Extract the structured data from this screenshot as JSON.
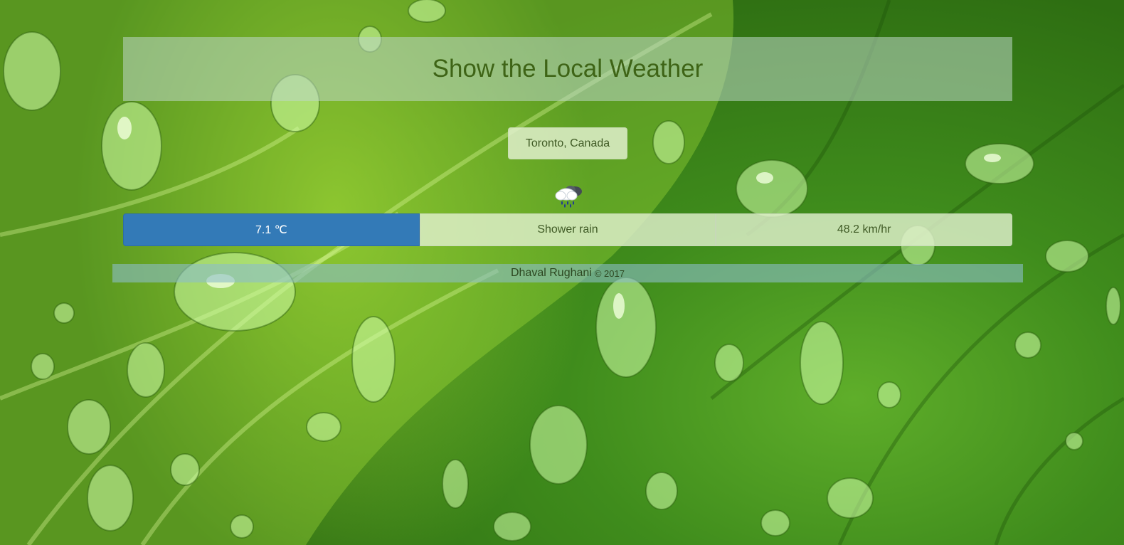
{
  "header": {
    "title": "Show the Local Weather"
  },
  "location": {
    "label": "Toronto, Canada"
  },
  "weather": {
    "icon": "shower-rain-icon",
    "temperature": "7.1 ℃",
    "description": "Shower rain",
    "wind": "48.2 km/hr"
  },
  "footer": {
    "author": "Dhaval Rughani",
    "copyright": "© 2017"
  },
  "colors": {
    "header_text": "#3e6416",
    "temperature_bg": "#337ab7",
    "leaf_green": "#6cbf25"
  }
}
